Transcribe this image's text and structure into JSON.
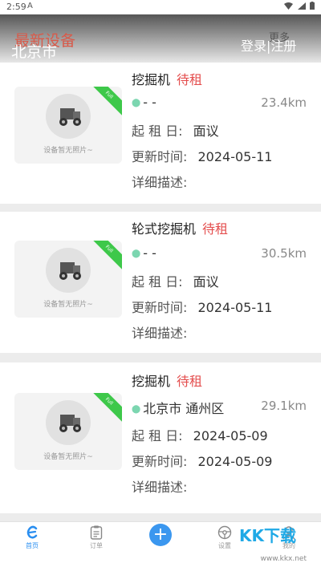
{
  "status_bar": {
    "time": "2:59",
    "apk_glyph": "A"
  },
  "header": {
    "section_title": "最新设备",
    "city": "北京市",
    "more": "更多",
    "login": "登录",
    "sep": "|",
    "register": "注册"
  },
  "placeholder_caption": "设备暂无照片~",
  "ribbon_text": "Full",
  "labels": {
    "start": "起 租 日:",
    "updated": "更新时间:",
    "detail": "详细描述:"
  },
  "listings": [
    {
      "name": "挖掘机",
      "status": "待租",
      "location": "- -",
      "distance": "23.4km",
      "start": "面议",
      "updated": "2024-05-11",
      "detail": ""
    },
    {
      "name": "轮式挖掘机",
      "status": "待租",
      "location": "- -",
      "distance": "30.5km",
      "start": "面议",
      "updated": "2024-05-11",
      "detail": ""
    },
    {
      "name": "挖掘机",
      "status": "待租",
      "location": "北京市 通州区",
      "distance": "29.1km",
      "start": "2024-05-09",
      "updated": "2024-05-09",
      "detail": ""
    }
  ],
  "tabs": [
    {
      "label": "首页",
      "icon": "home-e-icon"
    },
    {
      "label": "订单",
      "icon": "clipboard-icon"
    },
    {
      "label": "",
      "icon": "plus-icon"
    },
    {
      "label": "设置",
      "icon": "steering-wheel-icon"
    },
    {
      "label": "我的",
      "icon": "user-icon"
    }
  ],
  "colors": {
    "accent_blue": "#3b97ef",
    "status_red": "#e44f4f",
    "ribbon_green": "#3ec84a",
    "header_red": "#d85a4a"
  },
  "watermark": {
    "text": "KK下载",
    "url": "www.kkx.net"
  }
}
